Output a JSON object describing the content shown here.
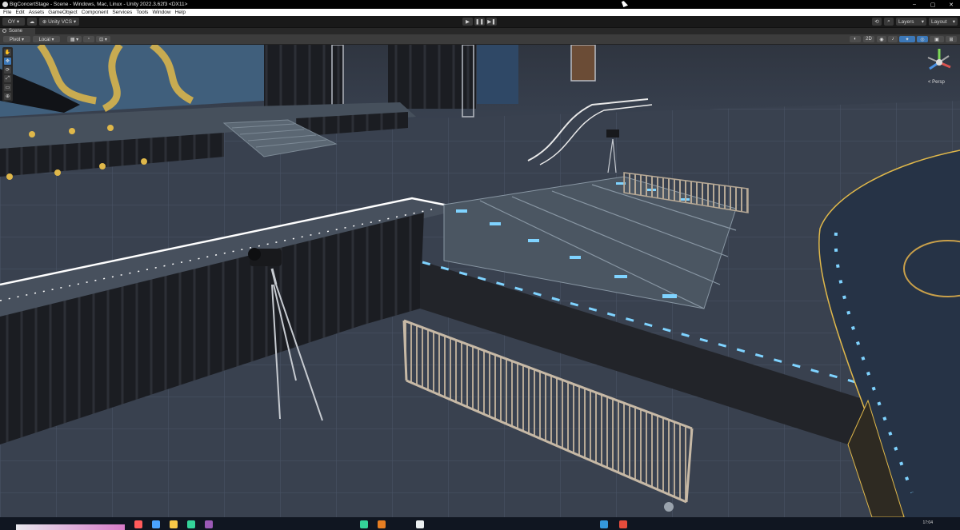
{
  "window": {
    "title": "BigConcertStage - Scene - Windows, Mac, Linux - Unity 2022.3.62f3 <DX11>",
    "minimize_glyph": "–",
    "maximize_glyph": "▢",
    "close_glyph": "✕"
  },
  "menu": [
    "File",
    "Edit",
    "Assets",
    "GameObject",
    "Component",
    "Services",
    "Tools",
    "Window",
    "Help"
  ],
  "toolbar": {
    "account_label": "OY ▾",
    "cloud_glyph": "☁",
    "vcs_label": "⊕ Unity VCS ▾",
    "play_glyph": "▶",
    "pause_glyph": "❚❚",
    "step_glyph": "▶❚",
    "history_glyph": "⟲",
    "search_glyph": "⌕",
    "layers_label": "Layers",
    "layout_label": "Layout",
    "dropdown_glyph": "▾"
  },
  "tabs": {
    "scene_label": "Scene"
  },
  "scene_toolbar": {
    "pivot_label": "Pivot ▾",
    "local_label": "Local ▾",
    "grid_label": "▦ ▾",
    "snap_label": "⊡ ▾",
    "view_2d_label": "2D",
    "right_icons": [
      "◐",
      "2D",
      "◉",
      "♪",
      "✦",
      "◎",
      "▣",
      "⊞"
    ]
  },
  "scene_tools": [
    "✋",
    "✥",
    "⟳",
    "⤢",
    "▭",
    "⊕"
  ],
  "gizmo": {
    "projection_label": "< Persp",
    "axis_colors": {
      "x": "#d9534f",
      "y": "#7ed957",
      "z": "#4a90e2"
    }
  },
  "taskbar": {
    "time": "17:04",
    "app_colors": [
      "#ff5b5b",
      "#4aa3ff",
      "#f7c948",
      "#34d399",
      "#9b59b6",
      "#e67e22",
      "#1abc9c",
      "#ecf0f1",
      "#3498db",
      "#e74c3c"
    ]
  },
  "colors": {
    "floor": "#3a4354",
    "stage_deck": "#46505c",
    "drape": "#1d1f24",
    "led_blue": "#7fd3ff",
    "accent_gold": "#e0b84a"
  }
}
